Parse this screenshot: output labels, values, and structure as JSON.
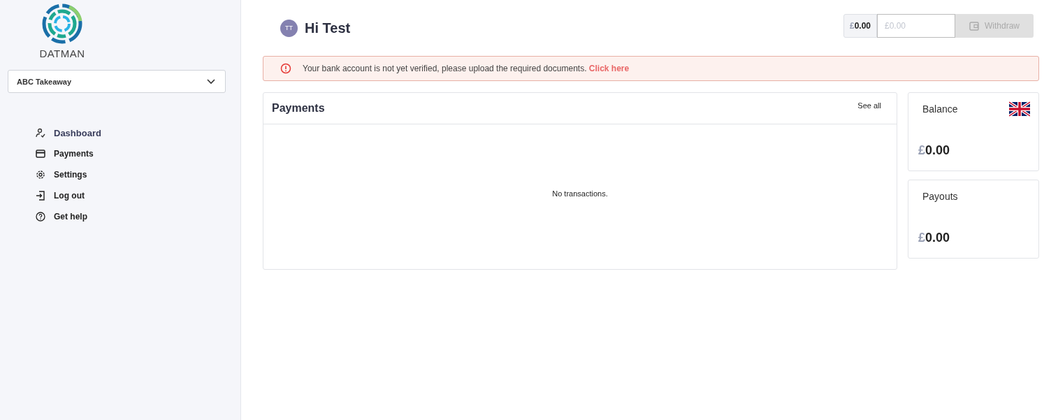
{
  "logo": {
    "text": "DATMAN"
  },
  "merchant_select": {
    "value": "ABC Takeaway"
  },
  "sidebar": {
    "items": [
      {
        "label": "Dashboard",
        "kind": "dashboard",
        "selected": true
      },
      {
        "label": "Payments",
        "kind": "payments",
        "selected": false
      },
      {
        "label": "Settings",
        "kind": "settings",
        "selected": false
      },
      {
        "label": "Log out",
        "kind": "logout",
        "selected": false
      },
      {
        "label": "Get help",
        "kind": "help",
        "selected": false
      }
    ]
  },
  "header": {
    "avatar": "TT",
    "greeting": "Hi Test",
    "withdraw": {
      "currency": "£",
      "amount": "0.00",
      "placeholder": "£0.00",
      "button": "Withdraw",
      "disabled": true
    }
  },
  "alert": {
    "text": "Your bank account is not yet verified, please upload the required documents.",
    "link": "Click here"
  },
  "payments": {
    "title": "Payments",
    "see_all": "See all",
    "empty": "No transactions."
  },
  "cards": [
    {
      "title": "Balance",
      "flag": true,
      "currency": "£",
      "amount": "0.00"
    },
    {
      "title": "Payouts",
      "flag": false,
      "currency": "£",
      "amount": "0.00"
    }
  ]
}
